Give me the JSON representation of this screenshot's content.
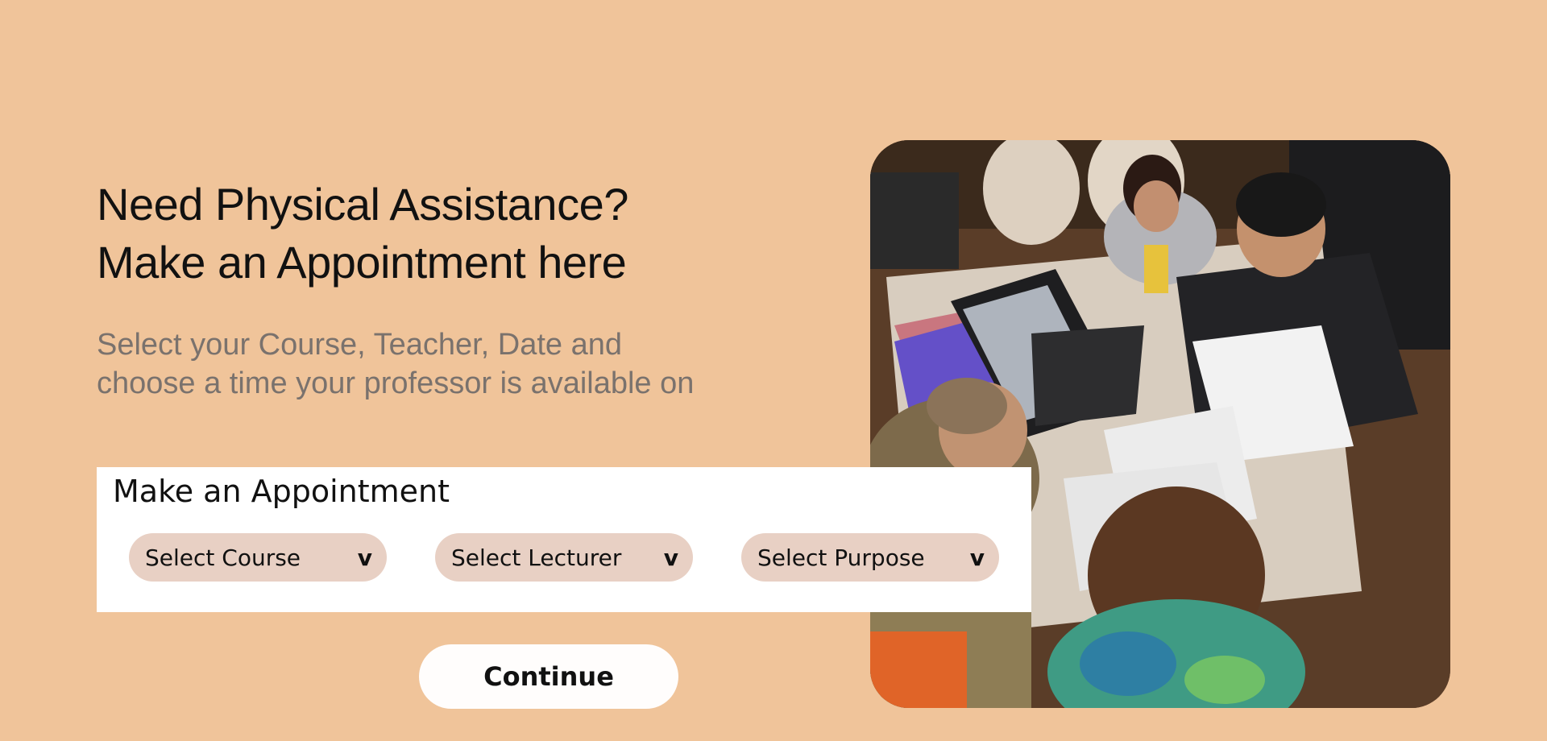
{
  "hero": {
    "headline_line1": "Need Physical Assistance?",
    "headline_line2": "Make an Appointment here",
    "subtext_line1": "Select your Course, Teacher, Date and",
    "subtext_line2": "choose a time your professor is available on"
  },
  "appointment_form": {
    "title": "Make an Appointment",
    "selects": [
      {
        "label": "Select Course",
        "chevron": "v"
      },
      {
        "label": "Select Lecturer",
        "chevron": "v"
      },
      {
        "label": "Select Purpose",
        "chevron": "v"
      }
    ]
  },
  "actions": {
    "continue_label": "Continue"
  },
  "colors": {
    "background": "#f0c49a",
    "select_fill": "#e8d0c4",
    "card": "#ffffff",
    "subtext": "#7a726d"
  },
  "image": {
    "subject": "students-studying-at-table-photo"
  }
}
